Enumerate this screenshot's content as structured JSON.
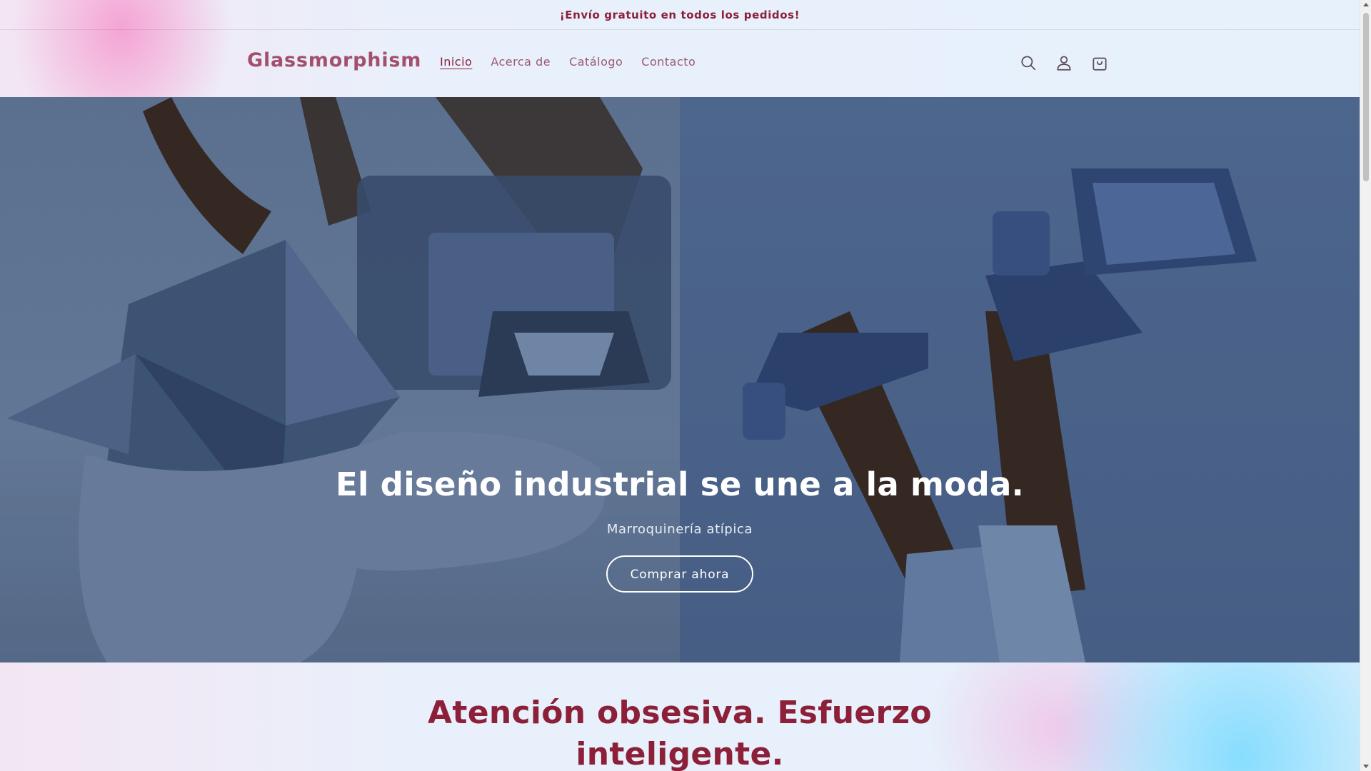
{
  "announcement": {
    "text": "¡Envío gratuito en todos los pedidos!"
  },
  "header": {
    "logo": "Glassmorphism",
    "nav": [
      {
        "label": "Inicio",
        "active": true
      },
      {
        "label": "Acerca de",
        "active": false
      },
      {
        "label": "Catálogo",
        "active": false
      },
      {
        "label": "Contacto",
        "active": false
      }
    ],
    "icons": [
      "search-icon",
      "account-icon",
      "cart-icon"
    ]
  },
  "hero": {
    "title": "El diseño industrial se une a la moda.",
    "subtitle": "Marroquinería atípica",
    "button": "Comprar ahora"
  },
  "section": {
    "title_line1": "Atención obsesiva. Esfuerzo",
    "title_line2": "inteligente."
  },
  "colors": {
    "accent": "#8c2039",
    "logo": "#a3506d",
    "hero_left": "#6d83a3",
    "hero_right": "#4e6690"
  }
}
